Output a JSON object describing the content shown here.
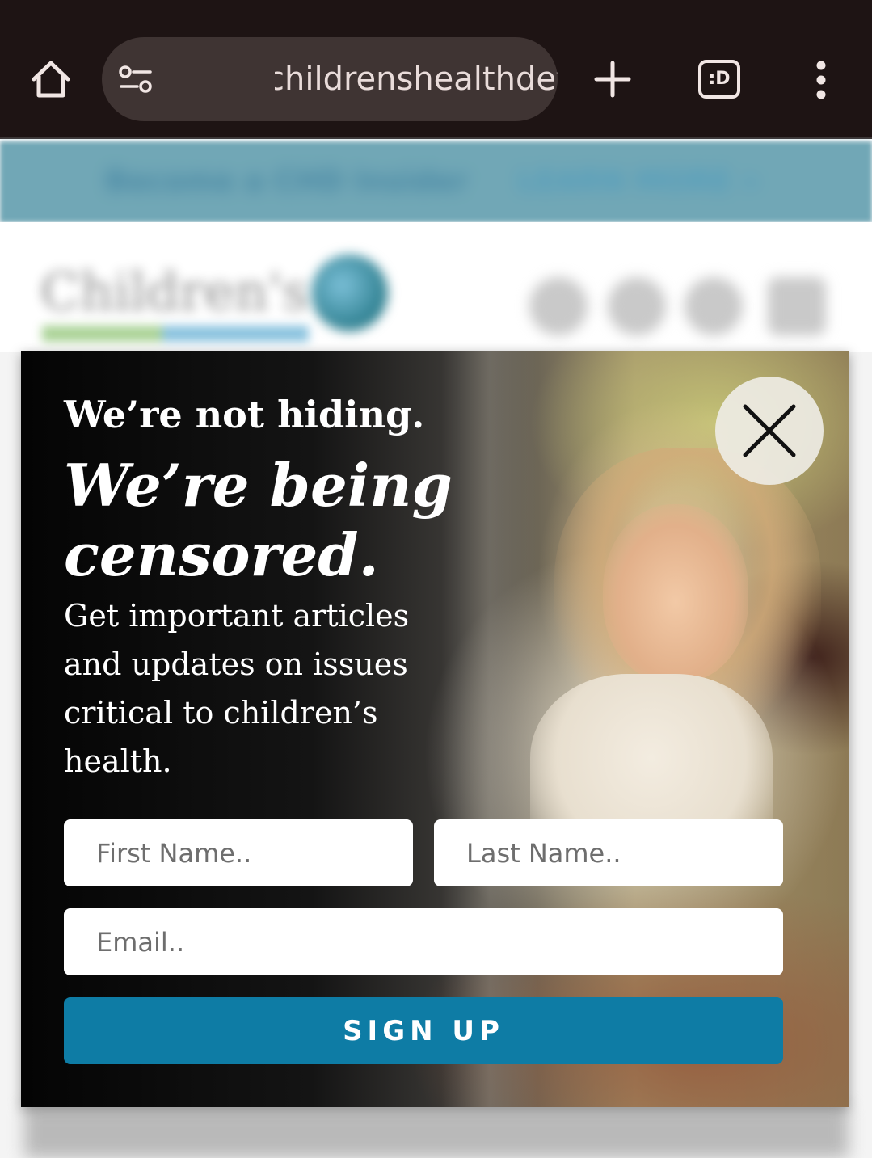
{
  "browser": {
    "url": "childrenshealthdefense.o",
    "tabs_label": ":D"
  },
  "background": {
    "promo_text": "Become a CHD Insider",
    "promo_link": "LEARN MORE »",
    "site_name": "Children's"
  },
  "modal": {
    "headline_1": "We’re not hiding.",
    "headline_2": "We’re being censored.",
    "body": "Get important articles and updates on issues critical to children’s health.",
    "first_name_placeholder": "First Name..",
    "last_name_placeholder": "Last Name..",
    "email_placeholder": "Email..",
    "signup_label": "SIGN UP",
    "button_color": "#0e7ca5"
  },
  "icons": {
    "home": "home-icon",
    "site_info": "tune-icon",
    "new_tab": "plus-icon",
    "tabs": "tab-switcher-icon",
    "menu": "more-vert-icon",
    "close": "close-icon"
  }
}
